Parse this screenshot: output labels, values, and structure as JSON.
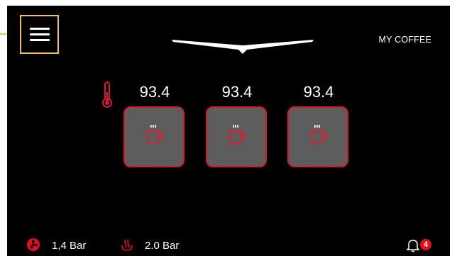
{
  "header": {
    "title": "MY COFFEE",
    "menu_icon": "hamburger-menu-icon",
    "logo_icon": "brand-chevron-logo"
  },
  "brewing": {
    "thermometer_icon": "thermometer-icon",
    "groups": [
      {
        "temperature": "93.4",
        "icon": "hot-coffee-cup-icon"
      },
      {
        "temperature": "93.4",
        "icon": "hot-coffee-cup-icon"
      },
      {
        "temperature": "93.4",
        "icon": "hot-coffee-cup-icon"
      }
    ]
  },
  "status_bar": {
    "pump_pressure": "1,4 Bar",
    "pump_icon": "fan-pump-icon",
    "steam_pressure": "2.0 Bar",
    "steam_icon": "steam-icon",
    "notification_icon": "bell-icon",
    "notification_count": "4"
  },
  "colors": {
    "accent": "#d7192a",
    "button_fill": "#5d5d5d",
    "highlight": "#f2c14e",
    "background": "#000000"
  }
}
